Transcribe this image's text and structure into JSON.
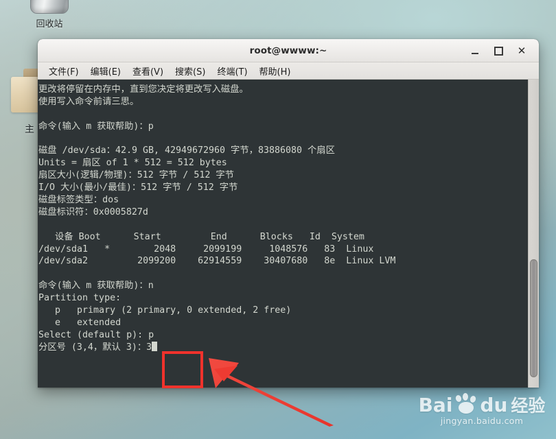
{
  "desktop": {
    "recycle_bin_label": "回收站",
    "home_label": "主"
  },
  "window": {
    "title": "root@wwww:~",
    "controls": {
      "minimize": "–",
      "maximize": "□",
      "close": "✕"
    }
  },
  "menubar": {
    "items": [
      {
        "label": "文件(F)"
      },
      {
        "label": "编辑(E)"
      },
      {
        "label": "查看(V)"
      },
      {
        "label": "搜索(S)"
      },
      {
        "label": "终端(T)"
      },
      {
        "label": "帮助(H)"
      }
    ]
  },
  "terminal": {
    "lines": [
      "更改将停留在内存中，直到您决定将更改写入磁盘。",
      "使用写入命令前请三思。",
      "",
      "命令(输入 m 获取帮助)：p",
      "",
      "磁盘 /dev/sda：42.9 GB, 42949672960 字节，83886080 个扇区",
      "Units = 扇区 of 1 * 512 = 512 bytes",
      "扇区大小(逻辑/物理)：512 字节 / 512 字节",
      "I/O 大小(最小/最佳)：512 字节 / 512 字节",
      "磁盘标签类型：dos",
      "磁盘标识符：0x0005827d",
      "",
      "   设备 Boot      Start         End      Blocks   Id  System",
      "/dev/sda1   *        2048     2099199     1048576   83  Linux",
      "/dev/sda2         2099200    62914559    30407680   8e  Linux LVM",
      "",
      "命令(输入 m 获取帮助)：n",
      "Partition type:",
      "   p   primary (2 primary, 0 extended, 2 free)",
      "   e   extended",
      "Select (default p): p",
      "分区号 (3,4，默认 3)：3"
    ],
    "cursor_visible": true,
    "background_color": "#2e3436",
    "foreground_color": "#d3d7cf"
  },
  "annotations": {
    "highlight_color": "#f0322c",
    "arrow_color": "#ee3b32"
  },
  "watermark": {
    "brand_bai": "Bai",
    "brand_du": "du",
    "brand_suffix": "经验",
    "url": "jingyan.baidu.com"
  }
}
